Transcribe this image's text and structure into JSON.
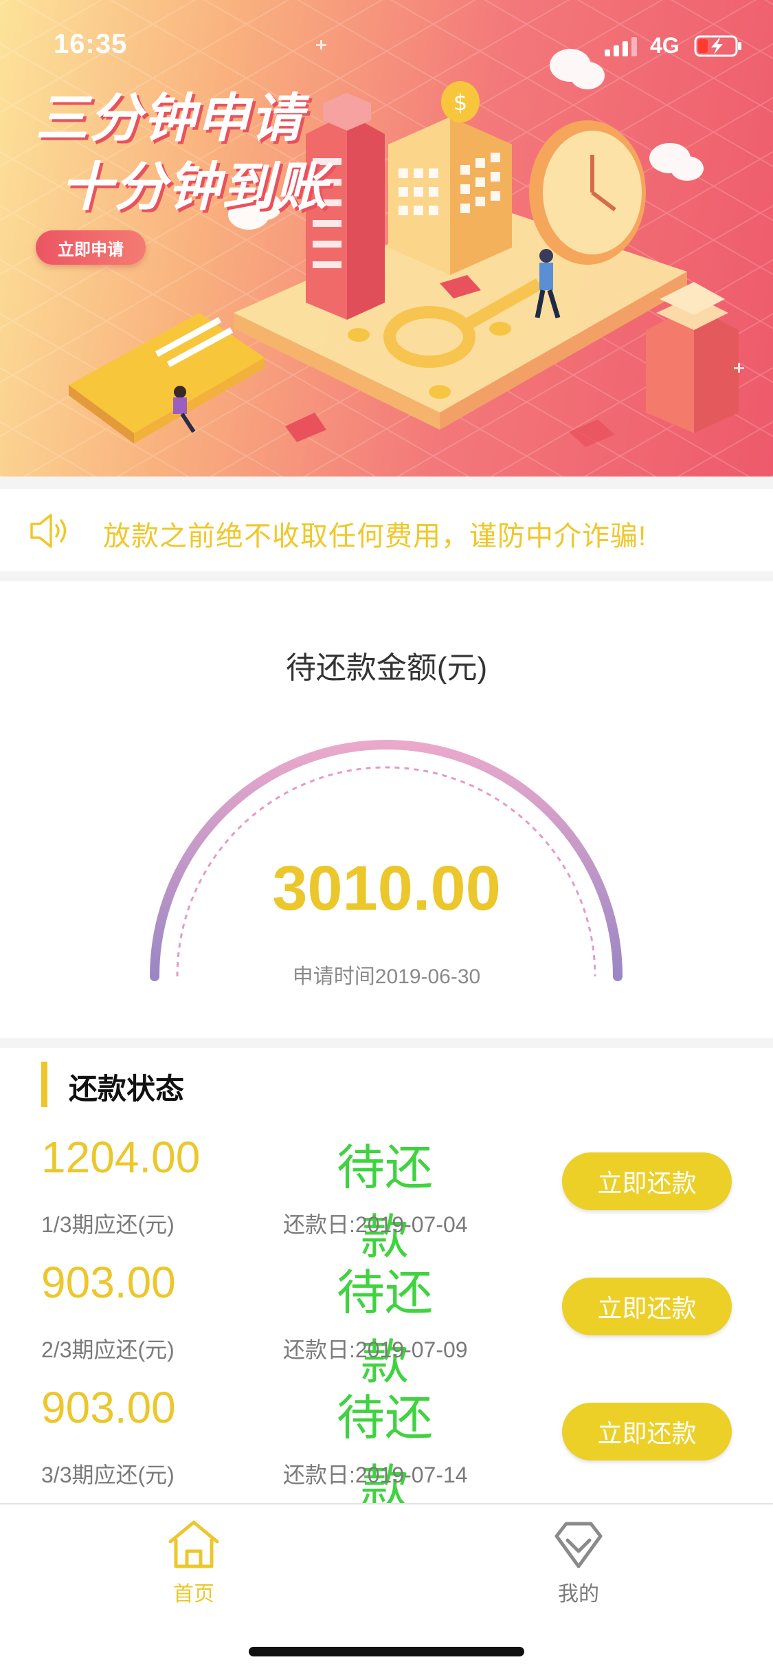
{
  "status_bar": {
    "time": "16:35",
    "network": "4G",
    "signal_icon": "signal-bars-icon",
    "battery_icon": "battery-charging-icon"
  },
  "banner": {
    "line1": "三分钟申请",
    "line2": "十分钟到账",
    "apply_button": "立即申请"
  },
  "notice": {
    "icon": "speaker-icon",
    "text": "放款之前绝不收取任何费用，谨防中介诈骗!"
  },
  "pending": {
    "title": "待还款金额(元)",
    "amount": "3010.00",
    "apply_date": "申请时间2019-06-30"
  },
  "repayment": {
    "title": "还款状态",
    "rows": [
      {
        "amount": "1204.00",
        "period": "1/3期应还(元)",
        "status": "待还款",
        "due_date": "还款日:2019-07-04",
        "button": "立即还款"
      },
      {
        "amount": "903.00",
        "period": "2/3期应还(元)",
        "status": "待还款",
        "due_date": "还款日:2019-07-09",
        "button": "立即还款"
      },
      {
        "amount": "903.00",
        "period": "3/3期应还(元)",
        "status": "待还款",
        "due_date": "还款日:2019-07-14",
        "button": "立即还款"
      }
    ]
  },
  "tabbar": {
    "tabs": [
      {
        "label": "首页",
        "icon": "home-icon",
        "active": true
      },
      {
        "label": "我的",
        "icon": "diamond-profile-icon",
        "active": false
      }
    ]
  },
  "colors": {
    "accent_yellow": "#ecc72b",
    "status_green": "#3fd33f",
    "button_yellow": "#ecd028",
    "gauge_top": "#eaa9cb",
    "gauge_bottom": "#9b86c4",
    "banner_red": "#ee5a6b"
  }
}
